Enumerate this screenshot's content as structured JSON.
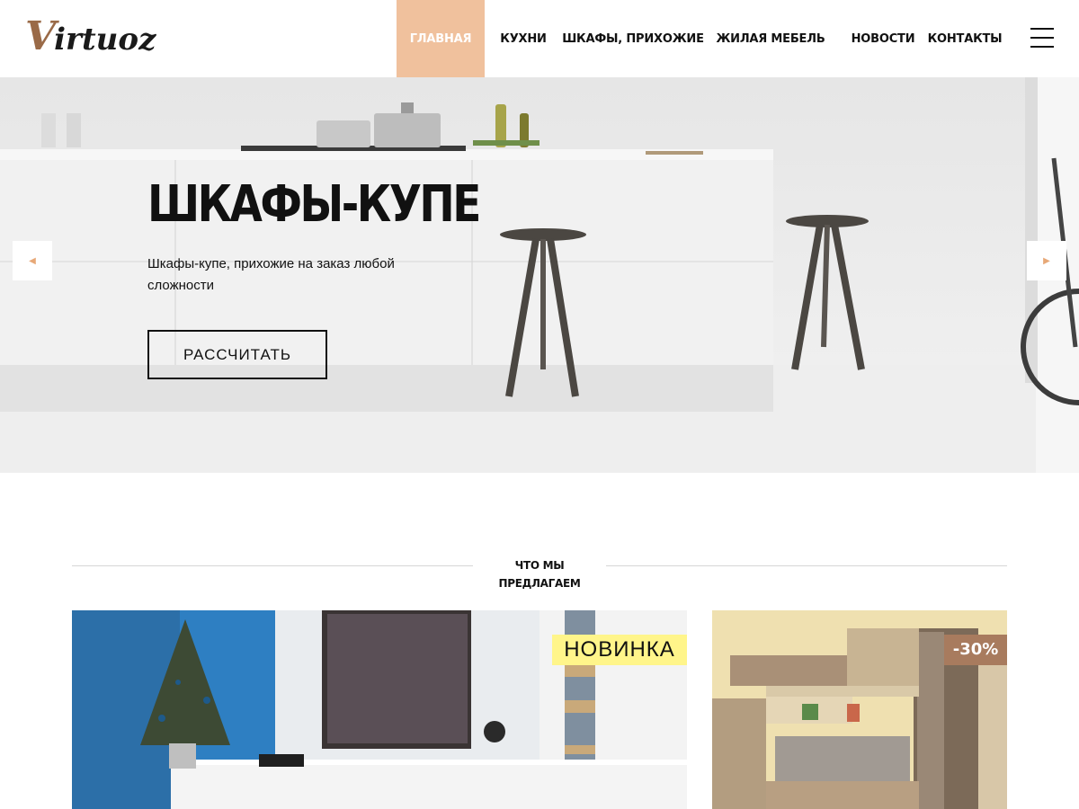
{
  "brand": {
    "logo_initial": "V",
    "logo_rest": "irtuoz",
    "colors": {
      "accent": "#f0c19d",
      "logo_brown": "#9a6a47",
      "new_badge": "#fff58a",
      "sale_badge": "#a87b5e"
    }
  },
  "nav": {
    "items": [
      {
        "label": "Главная",
        "active": true
      },
      {
        "label": "Кухни",
        "active": false
      },
      {
        "label": "Шкафы, прихожие",
        "active": false
      },
      {
        "label": "Жилая мебель",
        "active": false
      },
      {
        "label": "Новости",
        "active": false
      },
      {
        "label": "Контакты",
        "active": false
      }
    ],
    "menu_icon": "hamburger-icon"
  },
  "hero": {
    "title": "ШКАФЫ-КУПЕ",
    "text": "Шкафы-купе, прихожие на заказ любой сложности",
    "button": "РАССЧИТАТЬ",
    "prev_icon": "arrow-left-icon",
    "next_icon": "arrow-right-icon"
  },
  "section": {
    "title": "Что мы предлагаем"
  },
  "cards": [
    {
      "badge": "НОВИНКА"
    },
    {
      "badge": "-30%"
    }
  ]
}
